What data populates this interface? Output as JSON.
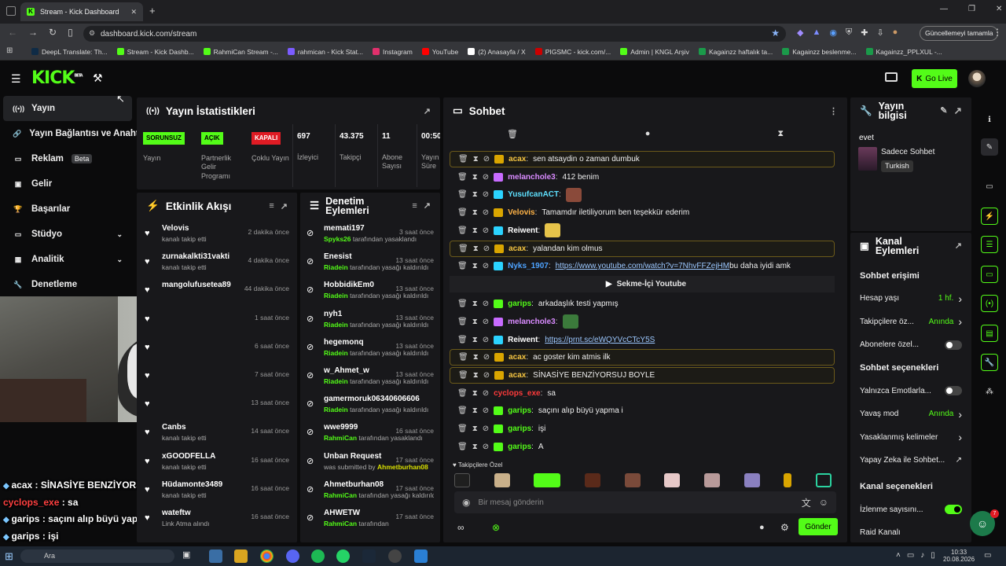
{
  "browser": {
    "tab_title": "Stream - Kick Dashboard",
    "url": "dashboard.kick.com/stream",
    "update_button": "Güncellemeyi tamamla",
    "bookmarks": [
      "DeepL Translate: Th...",
      "Stream - Kick Dashb...",
      "RahmiCan Stream -...",
      "rahmican - Kick Stat...",
      "Instagram",
      "YouTube",
      "(2) Anasayfa / X",
      "PIGSMC - kick.com/...",
      "Admin | KNGL Arşiv",
      "Kagainzz haftalık ta...",
      "Kagainzz beslenme...",
      "Kagainzz_PPLXUL -..."
    ]
  },
  "app": {
    "logo": "KICK",
    "logo_sup": "BETA",
    "go_live": "Go Live"
  },
  "sidebar": {
    "items": [
      {
        "label": "Yayın"
      },
      {
        "label": "Yayın Bağlantısı ve Anahtarı"
      },
      {
        "label": "Reklam",
        "badge": "Beta"
      },
      {
        "label": "Gelir"
      },
      {
        "label": "Başarılar"
      },
      {
        "label": "Stüdyo"
      },
      {
        "label": "Analitik"
      },
      {
        "label": "Denetleme"
      }
    ]
  },
  "stats": {
    "title": "Yayın İstatistikleri",
    "items": [
      {
        "value": "SORUNSUZ",
        "label": "Yayın",
        "kind": "green"
      },
      {
        "value": "AÇIK",
        "label": "Partnerlik Gelir Programı",
        "kind": "green"
      },
      {
        "value": "KAPALI",
        "label": "Çoklu Yayın",
        "kind": "red"
      },
      {
        "value": "697",
        "label": "İzleyici"
      },
      {
        "value": "43.375",
        "label": "Takipçi"
      },
      {
        "value": "11",
        "label": "Abone Sayısı"
      },
      {
        "value": "00:50",
        "label": "Yayın Oldu Süre"
      }
    ]
  },
  "activity": {
    "title": "Etkinlik Akışı",
    "items": [
      {
        "name": "Velovis",
        "sub": "kanalı takip etti",
        "time": "2 dakika önce"
      },
      {
        "name": "zurnakalkti31vakti",
        "sub": "kanalı takip etti",
        "time": "4 dakika önce"
      },
      {
        "name": "mangolufusetea89",
        "sub": "",
        "time": "44 dakika önce"
      },
      {
        "name": "",
        "sub": "",
        "time": "1 saat önce"
      },
      {
        "name": "",
        "sub": "",
        "time": "6 saat önce"
      },
      {
        "name": "",
        "sub": "",
        "time": "7 saat önce"
      },
      {
        "name": "",
        "sub": "",
        "time": "13 saat önce"
      },
      {
        "name": "Canbs",
        "sub": "kanalı takip etti",
        "time": "14 saat önce"
      },
      {
        "name": "xGOODFELLA",
        "sub": "kanalı takip etti",
        "time": "16 saat önce"
      },
      {
        "name": "Hüdamonte3489",
        "sub": "kanalı takip etti",
        "time": "16 saat önce"
      },
      {
        "name": "wateftw",
        "sub": "Link Atma alındı",
        "time": "16 saat önce"
      }
    ]
  },
  "moderation": {
    "title": "Denetim Eylemleri",
    "items": [
      {
        "name": "memati197",
        "by": "Spyks26",
        "sub": " tarafından yasaklandı",
        "time": "3 saat önce"
      },
      {
        "name": "Enesist",
        "by": "Riadein",
        "sub": " tarafından yasağı kaldırıldı",
        "time": "13 saat önce"
      },
      {
        "name": "HobbidikEm0",
        "by": "Riadein",
        "sub": " tarafından yasağı kaldırıldı",
        "time": "13 saat önce"
      },
      {
        "name": "nyh1",
        "by": "Riadein",
        "sub": " tarafından yasağı kaldırıldı",
        "time": "13 saat önce"
      },
      {
        "name": "hegemonq",
        "by": "Riadein",
        "sub": " tarafından yasağı kaldırıldı",
        "time": "13 saat önce"
      },
      {
        "name": "w_Ahmet_w",
        "by": "Riadein",
        "sub": " tarafından yasağı kaldırıldı",
        "time": "13 saat önce"
      },
      {
        "name": "gamermoruk06340606606",
        "by": "Riadein",
        "sub": " tarafından yasağı kaldırıldı",
        "time": ""
      },
      {
        "name": "wwe9999",
        "by": "RahmiCan",
        "sub": " tarafından yasaklandı",
        "time": "16 saat önce"
      },
      {
        "name": "Unban Request",
        "by": "Ahmetburhan08",
        "sub": "was submitted by ",
        "time": "17 saat önce"
      },
      {
        "name": "Ahmetburhan08",
        "by": "RahmiCan",
        "sub": " tarafından yasağı kaldırıldı",
        "time": "17 saat önce"
      },
      {
        "name": "AHWETW",
        "by": "RahmiCan",
        "sub": " tarafından",
        "time": "17 saat önce"
      }
    ]
  },
  "chat": {
    "title": "Sohbet",
    "followers_only": "Takipçilere Özel",
    "placeholder": "Bir mesaj gönderin",
    "send": "Gönder",
    "tab_label": "Sekme-İçi Youtube",
    "messages": [
      {
        "user": "acax",
        "color": "#f5c542",
        "text": "sen atsaydin o zaman dumbuk",
        "hl": true,
        "badge": "#d9a500"
      },
      {
        "user": "melanchole3",
        "color": "#d98bff",
        "text": "412 benim",
        "badge": "#c86bff"
      },
      {
        "user": "YusufcanACT",
        "color": "#5ee1ff",
        "text": "",
        "emote": "#8a4a3a",
        "badge": "#2bd3ff"
      },
      {
        "user": "Velovis",
        "color": "#ffb347",
        "text": "Tamamdır iletiliyorum ben teşekkür ederim",
        "badge": "#d9a500"
      },
      {
        "user": "Reiwent",
        "color": "#ffffff",
        "text": "",
        "emote": "#e6c34a",
        "badge": "#2bd3ff"
      },
      {
        "user": "acax",
        "color": "#f5c542",
        "text": "yalandan kim olmus",
        "hl": true,
        "badge": "#d9a500"
      },
      {
        "user": "Nyks_1907",
        "color": "#4ea3ff",
        "text": "https://www.youtube.com/watch?v=7NhvFFZejHM",
        "text2": " bu daha iyidi amk",
        "link": true,
        "badge": "#2bd3ff"
      },
      {
        "user": "garips",
        "color": "#53fc18",
        "text": "arkadaşlık testi yapmış",
        "badge": "#53fc18"
      },
      {
        "user": "melanchole3",
        "color": "#d98bff",
        "text": "",
        "emote": "#3b7a3b",
        "badge": "#c86bff"
      },
      {
        "user": "Reiwent",
        "color": "#ffffff",
        "text": "https://prnt.sc/eWQYVcCTcY5S",
        "link": true,
        "badge": "#2bd3ff"
      },
      {
        "user": "acax",
        "color": "#f5c542",
        "text": "ac goster kim atmis ilk",
        "hl": true,
        "badge": "#d9a500"
      },
      {
        "user": "acax",
        "color": "#f5c542",
        "text": "SİNASİYE BENZİYORSUJ BOYLE",
        "hl": true,
        "badge": "#d9a500"
      },
      {
        "user": "cyclops_exe",
        "color": "#ff3b3b",
        "text": "sa",
        "badge": ""
      },
      {
        "user": "garips",
        "color": "#53fc18",
        "text": "saçını alıp büyü yapma i",
        "badge": "#53fc18"
      },
      {
        "user": "garips",
        "color": "#53fc18",
        "text": "işi",
        "badge": "#53fc18"
      },
      {
        "user": "garips",
        "color": "#53fc18",
        "text": "A",
        "badge": "#53fc18"
      }
    ]
  },
  "info": {
    "title": "Yayın bilgisi",
    "stream_title": "evet",
    "category": "Sadece Sohbet",
    "language": "Turkish"
  },
  "channel": {
    "title": "Kanal Eylemleri",
    "chat_access": "Sohbet erişimi",
    "rows": [
      {
        "label": "Hesap yaşı",
        "value": "1 hf.",
        "type": "chev"
      },
      {
        "label": "Takipçilere öz...",
        "value": "Anında",
        "type": "chev"
      },
      {
        "label": "Abonelere özel...",
        "type": "toggle",
        "on": false
      }
    ],
    "options_title": "Sohbet seçenekleri",
    "options": [
      {
        "label": "Yalnızca Emotlarla...",
        "type": "toggle",
        "on": false
      },
      {
        "label": "Yavaş mod",
        "value": "Anında",
        "type": "chev"
      },
      {
        "label": "Yasaklanmış kelimeler",
        "type": "chev"
      },
      {
        "label": "Yapay Zeka ile Sohbet...",
        "type": "ext"
      }
    ],
    "channel_title": "Kanal seçenekleri",
    "channel_rows": [
      {
        "label": "İzlenme sayısını...",
        "type": "toggle",
        "on": true
      },
      {
        "label": "Raid Kanalı",
        "type": "none"
      }
    ]
  },
  "overlay": {
    "lines": [
      {
        "user": "acax",
        "text": " : SİNASİYE BENZİYORSUJ BOYLE",
        "color": "#ffffff"
      },
      {
        "user": "cyclops_exe",
        "text": " : sa",
        "color": "#ff4040"
      },
      {
        "user": "garips",
        "text": " : saçını alıp büyü yapma i",
        "color": "#ffffff"
      },
      {
        "user": "garips",
        "text": " : işi",
        "color": "#ffffff"
      }
    ]
  },
  "taskbar": {
    "time": "10:33",
    "date": "20.08.2026",
    "search": "Ara"
  },
  "notification_count": "7"
}
